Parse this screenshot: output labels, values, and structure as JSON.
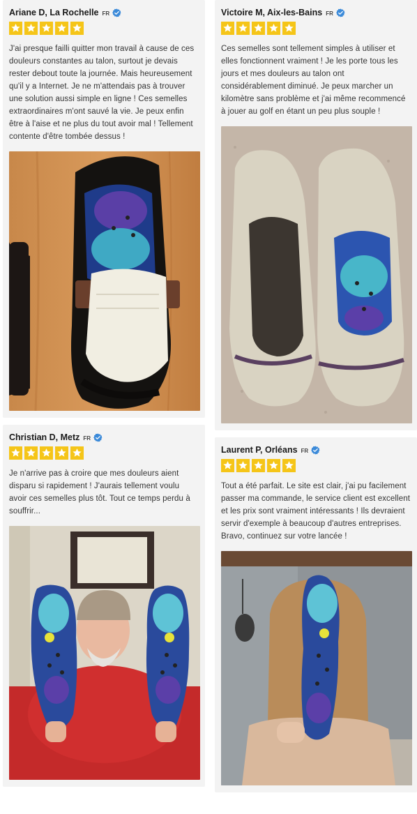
{
  "reviews": [
    {
      "name": "Ariane D, La Rochelle",
      "country": "FR",
      "rating": 5,
      "text": "J'ai presque failli quitter mon travail à cause de ces douleurs constantes au talon, surtout je devais rester debout toute la journée. Mais heureusement qu'il y a Internet. Je ne m'attendais pas à trouver une solution aussi simple en ligne ! Ces semelles extraordinaires m'ont sauvé la vie. Je peux enfin être à l'aise et ne plus du tout avoir mal ! Tellement contente d'être tombée dessus !",
      "photo_icon": "loafer-shoe-with-insole-photo"
    },
    {
      "name": "Victoire M, Aix-les-Bains",
      "country": "FR",
      "rating": 5,
      "text": "Ces semelles sont tellement simples à utiliser et elles fonctionnent vraiment ! Je les porte tous les jours et mes douleurs au talon ont considérablement diminué. Je peux marcher un kilomètre sans problème et j'ai même recommencé à jouer au golf en étant un peu plus souple !",
      "photo_icon": "canvas-shoes-with-insoles-photo"
    },
    {
      "name": "Christian D, Metz",
      "country": "FR",
      "rating": 5,
      "text": "Je n'arrive pas à croire que mes douleurs aient disparu si rapidement ! J'aurais tellement voulu avoir ces semelles plus tôt. Tout ce temps perdu à souffrir...",
      "photo_icon": "man-holding-insoles-photo"
    },
    {
      "name": "Laurent P, Orléans",
      "country": "FR",
      "rating": 5,
      "text": "Tout a été parfait. Le site est clair, j'ai pu facilement passer ma commande, le service client est excellent et les prix sont vraiment intéressants ! Ils devraient servir d'exemple à beaucoup d'autres entreprises. Bravo, continuez sur votre lancée !",
      "photo_icon": "woman-holding-insole-photo"
    }
  ],
  "colors": {
    "star": "#f5c518",
    "verified": "#3b8ad9",
    "card_bg": "#f3f3f3"
  }
}
